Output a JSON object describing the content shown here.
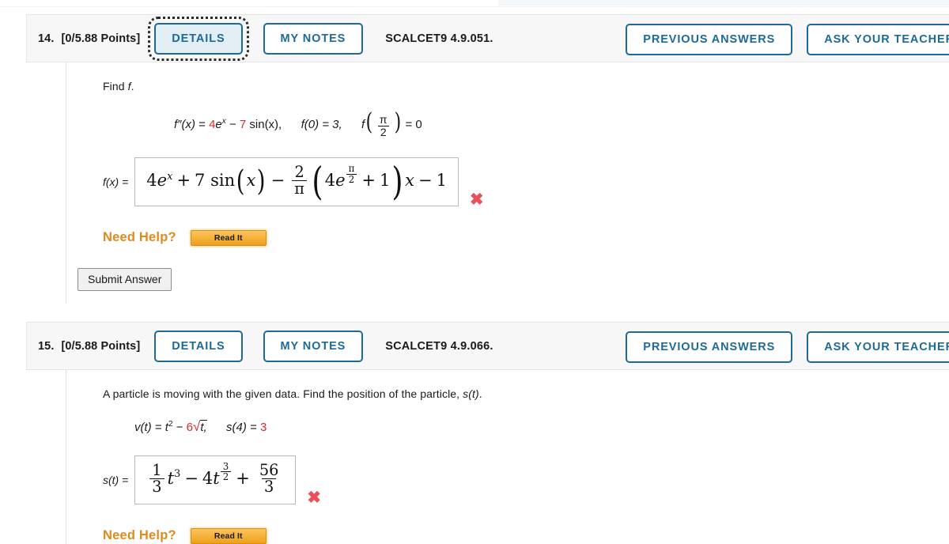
{
  "questions": [
    {
      "number": "14.",
      "points": "[0/5.88 Points]",
      "details_label": "DETAILS",
      "mynotes_label": "MY NOTES",
      "code": "SCALCET9 4.9.051.",
      "previous_answers_label": "PREVIOUS ANSWERS",
      "ask_teacher_label": "ASK YOUR TEACHER",
      "prompt_plain": "Find f.",
      "prompt": {
        "lead": "Find ",
        "italic": "f",
        "tail": "."
      },
      "given": {
        "fn": "f″(x)",
        "eq": "=",
        "coef_a": "4",
        "term_a": "e",
        "term_a_exp": "x",
        "minus": "−",
        "coef_b": "7",
        "term_b": "sin(x),",
        "cond1": "f(0) = 3,",
        "cond2_fn": "f",
        "cond2_num": "π",
        "cond2_den": "2",
        "cond2_eq": "= 0"
      },
      "answer_label": "f(x) =",
      "answer_latex": "4e^x + 7 sin(x) - (2/π)(4e^(π/2) + 1)x - 1",
      "answer_tokens": {
        "t1": "4",
        "t2": "e",
        "t2_exp": "x",
        "t3": "+",
        "t4": "7 sin",
        "t5": "(",
        "t6": "x",
        "t7": ")",
        "t8": "−",
        "f1_num": "2",
        "f1_den": "π",
        "t9": "4",
        "t10": "e",
        "e_num": "π",
        "e_den": "2",
        "t11": "+",
        "t12": "1",
        "t13": "x",
        "t14": "−",
        "t15": "1"
      },
      "grade_mark": "✖",
      "need_help_label": "Need Help?",
      "read_it_label": "Read It",
      "submit_label": "Submit Answer",
      "details_focused": true,
      "has_submit": true
    },
    {
      "number": "15.",
      "points": "[0/5.88 Points]",
      "details_label": "DETAILS",
      "mynotes_label": "MY NOTES",
      "code": "SCALCET9 4.9.066.",
      "previous_answers_label": "PREVIOUS ANSWERS",
      "ask_teacher_label": "ASK YOUR TEACHER",
      "prompt_plain": "A particle is moving with the given data. Find the position of the particle, s(t).",
      "prompt": {
        "lead": "A particle is moving with the given data. Find the position of the particle, ",
        "italic": "s(t)",
        "tail": "."
      },
      "given": {
        "fn": "v(t)",
        "eq": "=",
        "var": "t",
        "exp": "2",
        "minus": "−",
        "coef": "6",
        "radicand": "t,",
        "cond": "s(4) =",
        "cond_val": "3"
      },
      "answer_label": "s(t) =",
      "answer_latex": "(1/3)t^3 - 4t^(3/2) + 56/3",
      "answer_tokens": {
        "f1_num": "1",
        "f1_den": "3",
        "t1": "t",
        "t1_exp": "3",
        "t2": "−",
        "t3": "4",
        "t4": "t",
        "e_num": "3",
        "e_den": "2",
        "t5": "+",
        "f2_num": "56",
        "f2_den": "3"
      },
      "grade_mark": "✖",
      "need_help_label": "Need Help?",
      "read_it_label": "Read It",
      "details_focused": false,
      "has_submit": false
    }
  ]
}
